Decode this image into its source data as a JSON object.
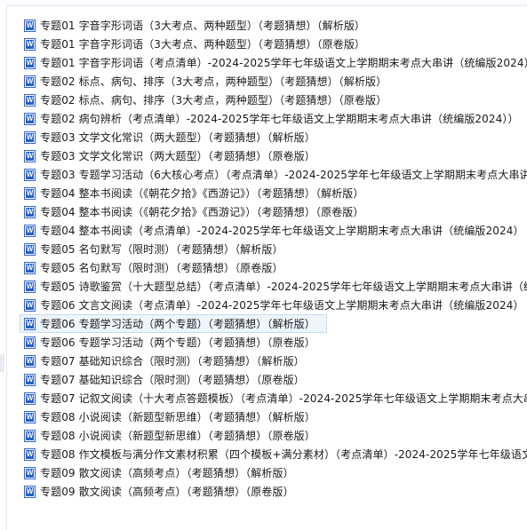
{
  "files": [
    {
      "name": "专题01 字音字形词语（3大考点、两种题型）（考题猜想）（解析版）"
    },
    {
      "name": "专题01 字音字形词语（3大考点、两种题型）（考题猜想）（原卷版）"
    },
    {
      "name": "专题01 字音字形词语（考点清单）-2024-2025学年七年级语文上学期期末考点大串讲（统编版2024）"
    },
    {
      "name": "专题02 标点、病句、排序（3大考点，两种题型）（考题猜想）（解析版）"
    },
    {
      "name": "专题02 标点、病句、排序（3大考点，两种题型）（考题猜想）（原卷版）"
    },
    {
      "name": "专题02 病句辨析（考点清单）-2024-2025学年七年级语文上学期期末考点大串讲（统编版2024））"
    },
    {
      "name": "专题03 文学文化常识（两大题型）（考题猜想）（解析版）"
    },
    {
      "name": "专题03 文学文化常识（两大题型）（考题猜想）（原卷版）"
    },
    {
      "name": "专题03 专题学习活动（6大核心考点）（考点清单）-2024-2025学年七年级语文上学期期末考点大串讲"
    },
    {
      "name": "专题04 整本书阅读（《朝花夕拾》《西游记》）（考题猜想）（解析版）"
    },
    {
      "name": "专题04 整本书阅读（《朝花夕拾》《西游记》）（考题猜想）（原卷版）"
    },
    {
      "name": "专题04 整本书阅读（考点清单）-2024-2025学年七年级语文上学期期末考点大串讲（统编版2024）"
    },
    {
      "name": "专题05 名句默写（限时测）（考题猜想）（解析版）"
    },
    {
      "name": "专题05 名句默写（限时测）（考题猜想）（原卷版）"
    },
    {
      "name": "专题05 诗歌鉴赏（十大题型总结）（考点清单）-2024-2025学年七年级语文上学期期末考点大串讲（统"
    },
    {
      "name": "专题06 文言文阅读（考点清单）-2024-2025学年七年级语文上学期期末考点大串讲（统编版2024）"
    },
    {
      "name": "专题06 专题学习活动（两个专题）（考题猜想）（解析版）"
    },
    {
      "name": "专题06 专题学习活动（两个专题）（考题猜想）（原卷版）"
    },
    {
      "name": "专题07 基础知识综合（限时测）（考题猜想）（解析版）"
    },
    {
      "name": "专题07 基础知识综合（限时测）（考题猜想）（原卷版）"
    },
    {
      "name": "专题07 记叙文阅读（十大考点答题模板）（考点清单）-2024-2025学年七年级语文上学期期末考点大串"
    },
    {
      "name": "专题08 小说阅读（新题型新思维）（考题猜想）（解析版）"
    },
    {
      "name": "专题08 小说阅读（新题型新思维）（考题猜想）（原卷版）"
    },
    {
      "name": "专题08 作文模板与满分作文素材积累（四个模板+满分素材）（考点清单）-2024-2025学年七年级语文"
    },
    {
      "name": "专题09 散文阅读（高频考点）（考题猜想）（解析版）"
    },
    {
      "name": "专题09 散文阅读（高频考点）（考题猜想）（原卷版）"
    }
  ],
  "selected_index": 16,
  "icon": "word-document-icon",
  "colors": {
    "icon_blue": "#2b5fc0",
    "selection_bg": "#eef5fd",
    "selection_border": "#c8daf3"
  }
}
